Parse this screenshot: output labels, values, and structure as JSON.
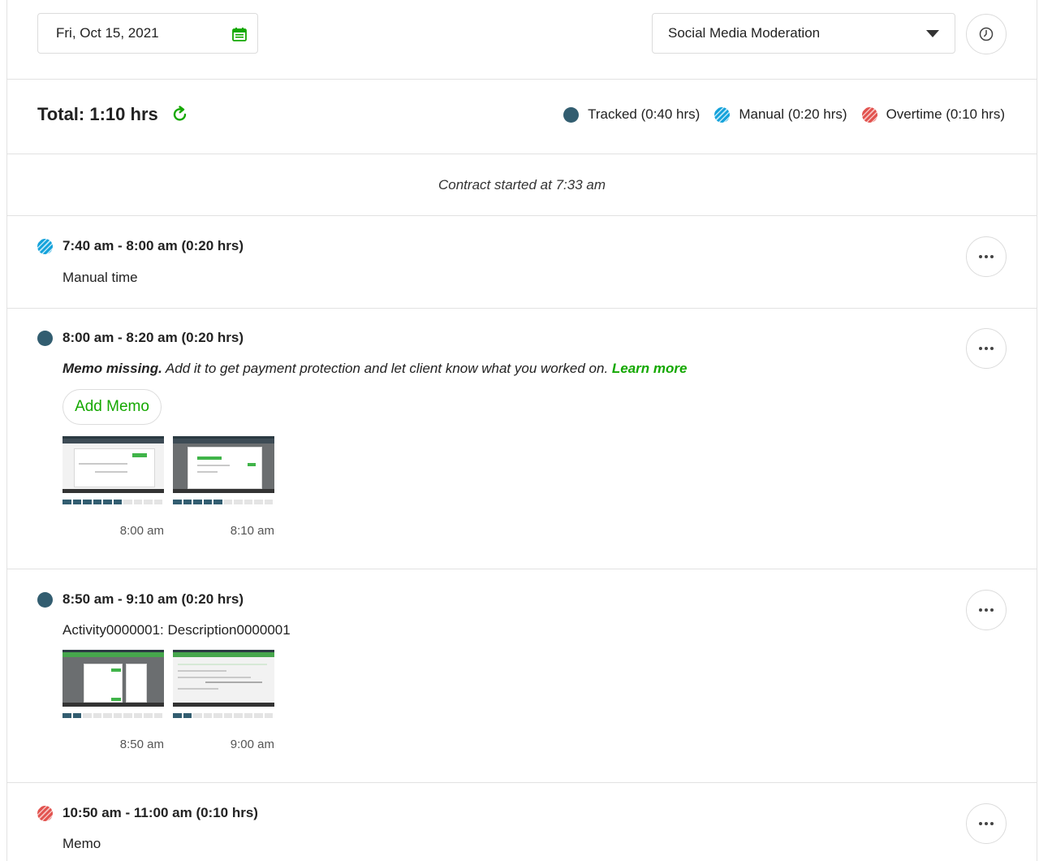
{
  "header": {
    "date": "Fri, Oct 15, 2021",
    "contract_select": "Social Media Moderation"
  },
  "summary": {
    "total": "Total: 1:10 hrs",
    "legend": [
      {
        "type": "tracked",
        "label": "Tracked (0:40 hrs)"
      },
      {
        "type": "manual",
        "label": "Manual (0:20 hrs)"
      },
      {
        "type": "overtime",
        "label": "Overtime (0:10 hrs)"
      }
    ]
  },
  "contract_started": "Contract started at 7:33 am",
  "segments": [
    {
      "type": "manual",
      "time": "7:40 am - 8:00 am (0:20 hrs)",
      "description": "Manual time"
    },
    {
      "type": "tracked",
      "time": "8:00 am - 8:20 am (0:20 hrs)",
      "memo_missing_bold": "Memo missing.",
      "memo_missing_text": " Add it to get payment protection and let client know what you worked on. ",
      "learn_more": "Learn more",
      "add_memo": "Add Memo",
      "screenshots": [
        {
          "time": "8:00 am",
          "activity_on": 6,
          "activity_total": 10
        },
        {
          "time": "8:10 am",
          "activity_on": 5,
          "activity_total": 10
        }
      ]
    },
    {
      "type": "tracked",
      "time": "8:50 am - 9:10 am (0:20 hrs)",
      "description": "Activity0000001: Description0000001",
      "screenshots": [
        {
          "time": "8:50 am",
          "activity_on": 2,
          "activity_total": 10
        },
        {
          "time": "9:00 am",
          "activity_on": 2,
          "activity_total": 10
        }
      ]
    },
    {
      "type": "overtime",
      "time": "10:50 am - 11:00 am (0:10 hrs)",
      "description": "Memo"
    }
  ],
  "colors": {
    "tracked": "#325d70",
    "manual": "#16a3db",
    "overtime": "#e2534f",
    "accent_green": "#14a800"
  },
  "icons": {
    "date": "calendar-icon",
    "select": "caret-down-icon",
    "timezone": "clock-icon",
    "refresh": "refresh-icon",
    "more": "more-icon"
  }
}
